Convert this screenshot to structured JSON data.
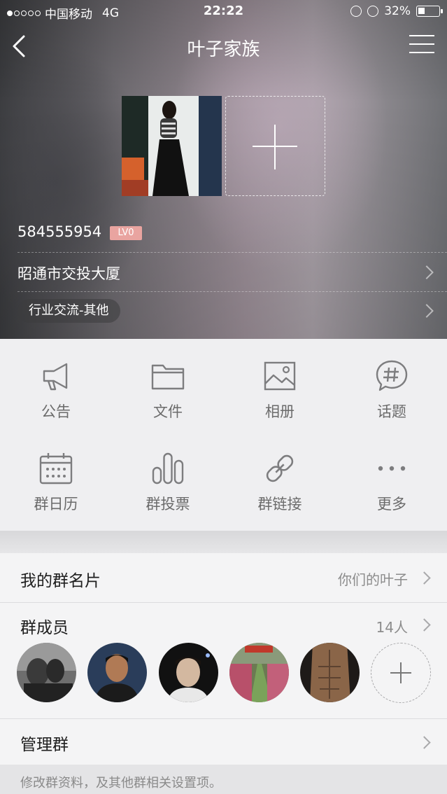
{
  "status_bar": {
    "carrier": "中国移动",
    "network": "4G",
    "time": "22:22",
    "battery": "32%"
  },
  "nav": {
    "title": "叶子家族",
    "back_icon": "chevron-left-icon",
    "menu_icon": "hamburger-menu-icon"
  },
  "group": {
    "id": "584555954",
    "level": "LV0",
    "location": "昭通市交投大厦",
    "category": "行业交流-其他"
  },
  "features": [
    {
      "label": "公告",
      "icon": "megaphone-icon"
    },
    {
      "label": "文件",
      "icon": "folder-icon"
    },
    {
      "label": "相册",
      "icon": "photo-album-icon"
    },
    {
      "label": "话题",
      "icon": "hashtag-bubble-icon"
    },
    {
      "label": "群日历",
      "icon": "calendar-icon"
    },
    {
      "label": "群投票",
      "icon": "bar-chart-icon"
    },
    {
      "label": "群链接",
      "icon": "link-icon"
    },
    {
      "label": "更多",
      "icon": "more-dots-icon"
    }
  ],
  "my_card": {
    "title": "我的群名片",
    "value": "你们的叶子"
  },
  "members": {
    "title": "群成员",
    "count": "14人"
  },
  "manage": {
    "title": "管理群",
    "description": "修改群资料，及其他群相关设置项。"
  },
  "colors": {
    "level_badge": "#e9a4a0",
    "icon_gray": "#7d7d7f",
    "background": "#efeff1"
  }
}
